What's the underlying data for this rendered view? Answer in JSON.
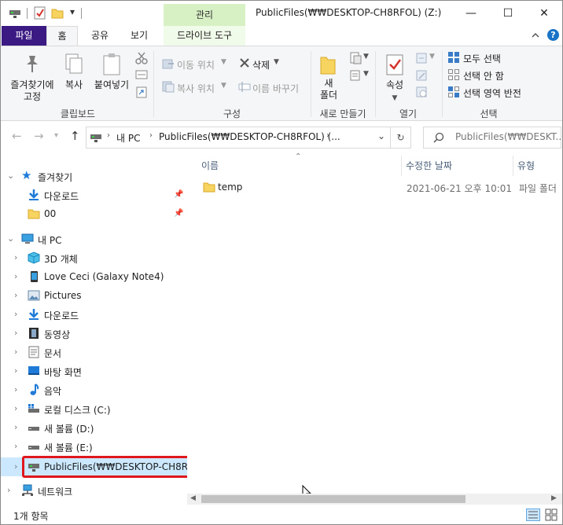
{
  "window": {
    "title": "PublicFiles(₩₩DESKTOP-CH8RFOL) (Z:)",
    "context_tab": "관리",
    "controls": {
      "minimize": "—",
      "maximize": "☐",
      "close": "✕"
    }
  },
  "quick_access": {
    "dropdown": "▾"
  },
  "tabs": [
    {
      "label": "파일"
    },
    {
      "label": "홈"
    },
    {
      "label": "공유"
    },
    {
      "label": "보기"
    },
    {
      "label": "드라이브 도구"
    }
  ],
  "ribbon": {
    "help": "?",
    "clipboard": {
      "label": "클립보드",
      "pin_line1": "즐겨찾기에",
      "pin_line2": "고정",
      "copy": "복사",
      "paste": "붙여넣기"
    },
    "organize": {
      "label": "구성",
      "move_to": "이동 위치",
      "copy_to": "복사 위치",
      "delete": "삭제",
      "rename": "이름 바꾸기"
    },
    "new": {
      "label": "새로 만들기",
      "new_folder_line1": "새",
      "new_folder_line2": "폴더"
    },
    "open": {
      "label": "열기",
      "properties": "속성"
    },
    "select": {
      "label": "선택",
      "select_all": "모두 선택",
      "select_none": "선택 안 함",
      "invert": "선택 영역 반전"
    }
  },
  "address": {
    "crumb_1": "내 PC",
    "crumb_2": "PublicFiles(₩₩DESKTOP-CH8RFOL) (...",
    "search_placeholder": "PublicFiles(₩₩DESKT..."
  },
  "nav": {
    "favorites": "즐겨찾기",
    "downloads_fav": "다운로드",
    "folder_00": "00",
    "this_pc": "내 PC",
    "objects3d": "3D 개체",
    "phone": "Love Ceci (Galaxy Note4)",
    "pictures": "Pictures",
    "downloads": "다운로드",
    "videos": "동영상",
    "documents": "문서",
    "desktop": "바탕 화면",
    "music": "음악",
    "local_disk": "로컬 디스크 (C:)",
    "vol_d": "새 볼륨 (D:)",
    "vol_e": "새 볼륨 (E:)",
    "public_files": "PublicFiles(₩₩DESKTOP-CH8RFO",
    "network": "네트워크"
  },
  "columns": {
    "name": "이름",
    "modified": "수정한 날짜",
    "type": "유형"
  },
  "files": [
    {
      "name": "temp",
      "modified": "2021-06-21 오후 10:01",
      "type": "파일 폴더"
    }
  ],
  "status": {
    "count": "1개 항목"
  },
  "colors": {
    "file_tab": "#3b1a83",
    "context_tab": "#d7f0c4",
    "highlight": "#e0161d",
    "selected_row": "#cce8ff"
  }
}
